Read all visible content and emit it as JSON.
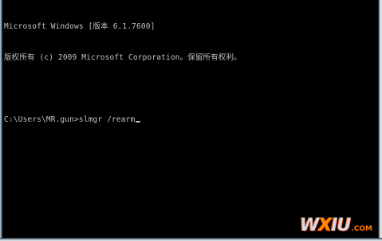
{
  "console": {
    "lines": [
      "Microsoft Windows [版本 6.1.7600]",
      "版权所有 (c) 2009 Microsoft Corporation。保留所有权利。",
      ""
    ],
    "prompt": "C:\\Users\\MR.gun>",
    "command": "slmgr /rearm"
  },
  "watermark": {
    "main_a": "W",
    "main_accent": "X",
    "main_b": "IU",
    "suffix": ".COM"
  },
  "colors": {
    "background": "#000000",
    "text": "#c0c0c0",
    "watermark_accent": "#ff8a00"
  }
}
